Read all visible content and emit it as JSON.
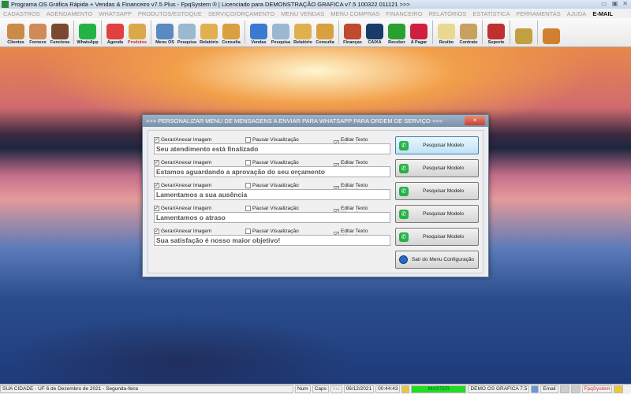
{
  "window": {
    "title": "Programa OS Gráfica Rápida + Vendas & Financeiro v7.5 Plus - FpqSystem ® | Licenciado para  DEMONSTRAÇÃO GRAFICA v7.5 100322 011121 >>>"
  },
  "menu": [
    "CADASTROS",
    "AGENDAMENTO",
    "WHATSAPP",
    "PRODUTOS/ESTOQUE",
    "SERVIÇO/ORÇAMENTO",
    "MENU VENDAS",
    "MENU COMPRAS",
    "FINANCEIRO",
    "RELATÓRIOS",
    "ESTATÍSTICA",
    "FERRAMENTAS",
    "AJUDA"
  ],
  "menu_email": "E-MAIL",
  "toolbar": [
    {
      "label": "Clientes",
      "icon": "clients-icon",
      "color": "#c98a4a"
    },
    {
      "label": "Fornece",
      "icon": "supplier-icon",
      "color": "#d08a5a"
    },
    {
      "label": "Funciona",
      "icon": "employees-icon",
      "color": "#7a4a30"
    },
    {
      "label": "WhatsApp",
      "icon": "whatsapp-icon",
      "color": "#25b245"
    },
    {
      "label": "Agenda",
      "icon": "calendar-icon",
      "color": "#e04040"
    },
    {
      "label": "Produtos",
      "icon": "boxes-icon",
      "color": "#d9a84a"
    },
    {
      "label": "Menu OS",
      "icon": "clipboard-icon",
      "color": "#5a8ac0"
    },
    {
      "label": "Pesquisa",
      "icon": "search-docs-icon",
      "color": "#9ab8d0"
    },
    {
      "label": "Relatório",
      "icon": "printer-icon",
      "color": "#e0b050"
    },
    {
      "label": "Consulta",
      "icon": "folder-icon",
      "color": "#d8a040"
    },
    {
      "label": "Vendas",
      "icon": "monitor-icon",
      "color": "#3a7ad0"
    },
    {
      "label": "Pesquisa",
      "icon": "search-docs-icon",
      "color": "#9ab8d0"
    },
    {
      "label": "Relatório",
      "icon": "printer-icon",
      "color": "#e0b050"
    },
    {
      "label": "Consulta",
      "icon": "folder-icon",
      "color": "#d8a040"
    },
    {
      "label": "Finanças",
      "icon": "finance-chart-icon",
      "color": "#c04a30"
    },
    {
      "label": "CAIXA",
      "icon": "cash-book-icon",
      "color": "#1a3a6a"
    },
    {
      "label": "Receber",
      "icon": "receive-money-icon",
      "color": "#2aa030"
    },
    {
      "label": "A Pagar",
      "icon": "pay-money-icon",
      "color": "#d02040"
    },
    {
      "label": "Resibo",
      "icon": "receipt-icon",
      "color": "#e8d890"
    },
    {
      "label": "Contrato",
      "icon": "contract-icon",
      "color": "#c8a060"
    },
    {
      "label": "Suporte",
      "icon": "support-icon",
      "color": "#c03030"
    },
    {
      "label": "",
      "icon": "coin-icon",
      "color": "#c0a040"
    },
    {
      "label": "",
      "icon": "exit-door-icon",
      "color": "#d08030"
    }
  ],
  "dialog": {
    "title": ">>> PERSONALIZAR MENU DE MENSAGENS A ENVIAR PARA WHATSAPP PARA ORDEM DE SERVIÇO <<<",
    "close": "×",
    "rows": [
      {
        "gerar": "Gerar/Anexar Imagem",
        "pausar": "Pausar Visualização",
        "editar": "Editar Texto WhatsApp",
        "message": "Seu atendimento está finalizado",
        "button": "Pesquisar Modelo"
      },
      {
        "gerar": "Gerar/Anexar Imagem",
        "pausar": "Pausar Visualização",
        "editar": "Editar Texto WhatsApp",
        "message": "Estamos aguardando a aprovação do seu orçamento",
        "button": "Pesquisar Modelo"
      },
      {
        "gerar": "Gerar/Anexar Imagem",
        "pausar": "Pausar Visualização",
        "editar": "Editar Texto WhatsApp",
        "message": "Lamentamos a sua ausência",
        "button": "Pesquisar Modelo"
      },
      {
        "gerar": "Gerar/Anexar Imagem",
        "pausar": "Pausar Visualização",
        "editar": "Editar Texto WhatsApp",
        "message": "Lamentamos o atraso",
        "button": "Pesquisar Modelo"
      },
      {
        "gerar": "Gerar/Anexar Imagem",
        "pausar": "Pausar Visualização",
        "editar": "Editar Texto WhatsApp",
        "message": "Sua satisfação é nosso maior objetivo!",
        "button": "Pesquisar Modelo"
      }
    ],
    "exit_button": "Sair do Menu Configuração"
  },
  "status": {
    "location": "SUA CIDADE - UF  6 de Dezembro de 2021 - Segunda-feira",
    "num": "Num",
    "caps": "Caps",
    "ins": "Ins",
    "date": "06/12/2021",
    "time": "00:44:43",
    "user": "MASTER",
    "company": "DEMO OS GRAFICA 7.5",
    "email": "Email",
    "brand": "FpqSystem"
  }
}
